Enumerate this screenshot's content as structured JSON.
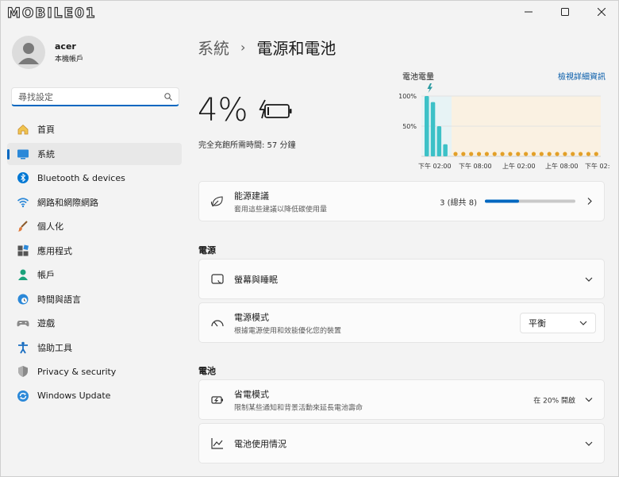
{
  "logo_text": "MOBILE01",
  "user": {
    "name": "acer",
    "subtitle": "本機帳戶"
  },
  "search": {
    "placeholder": "尋找設定"
  },
  "nav": [
    {
      "label": "首頁",
      "icon": "home-icon"
    },
    {
      "label": "系統",
      "icon": "system-icon",
      "active": true
    },
    {
      "label": "Bluetooth & devices",
      "icon": "bluetooth-icon"
    },
    {
      "label": "網路和網際網路",
      "icon": "wifi-icon"
    },
    {
      "label": "個人化",
      "icon": "brush-icon"
    },
    {
      "label": "應用程式",
      "icon": "apps-icon"
    },
    {
      "label": "帳戶",
      "icon": "person-icon"
    },
    {
      "label": "時間與語言",
      "icon": "globe-clock-icon"
    },
    {
      "label": "遊戲",
      "icon": "gamepad-icon"
    },
    {
      "label": "協助工具",
      "icon": "accessibility-icon"
    },
    {
      "label": "Privacy & security",
      "icon": "shield-icon"
    },
    {
      "label": "Windows Update",
      "icon": "update-icon"
    }
  ],
  "breadcrumb": {
    "parent": "系統",
    "separator": "›",
    "current": "電源和電池"
  },
  "battery": {
    "percent": "4%",
    "percent_value": 4,
    "charge_time": "完全充飽所需時間: 57 分鐘"
  },
  "chart_title": "電池電量",
  "details_link": "檢視詳細資訊",
  "chart_data": {
    "type": "bar",
    "y_ticks": [
      "100%",
      "50%"
    ],
    "x_ticks": [
      "下午 02:00",
      "下午 08:00",
      "上午 02:00",
      "上午 08:00",
      "下午 02:00"
    ],
    "bars": [
      100,
      90,
      50,
      20
    ],
    "ylim": [
      0,
      100
    ],
    "colors": {
      "bar": "#3cc1c7",
      "dot": "#e3a028",
      "plug_region": "#e7f3f5",
      "saver_region": "#faf1e2"
    }
  },
  "energy": {
    "title": "能源建議",
    "subtitle": "套用這些建議以降低碳使用量",
    "count": "3 (總共 8)",
    "progress": 0.375
  },
  "power_section": "電源",
  "screen_sleep": {
    "title": "螢幕與睡眠"
  },
  "power_mode": {
    "title": "電源模式",
    "subtitle": "根據電源使用和效能優化您的裝置",
    "value": "平衡"
  },
  "battery_section": "電池",
  "saver": {
    "title": "省電模式",
    "subtitle": "限制某些通知和背景活動來延長電池壽命",
    "status": "在 20% 開啟"
  },
  "usage": {
    "title": "電池使用情況"
  },
  "accent": "#0067c0"
}
